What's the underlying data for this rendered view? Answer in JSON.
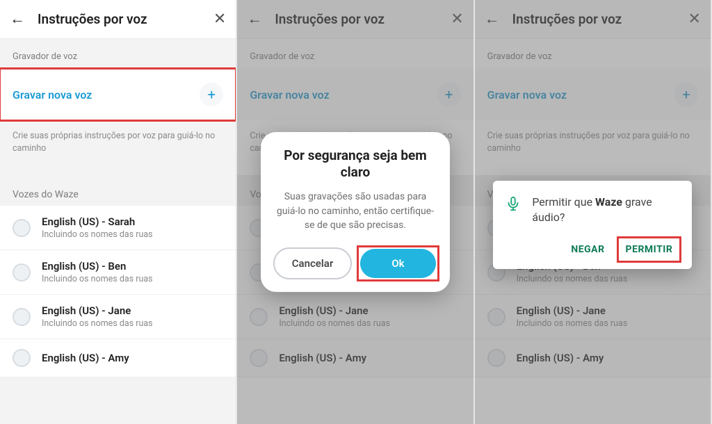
{
  "header": {
    "title": "Instruções por voz"
  },
  "recorder": {
    "section_label": "Gravador de voz",
    "record_label": "Gravar nova voz",
    "helper": "Crie suas próprias instruções por voz para guiá-lo no caminho"
  },
  "voices": {
    "section_label": "Vozes do Waze",
    "sub_label": "Incluindo os nomes das ruas",
    "items": [
      {
        "name": "English (US) - Sarah"
      },
      {
        "name": "English (US) - Ben"
      },
      {
        "name": "English (US) - Jane"
      },
      {
        "name": "English (US) - Amy"
      }
    ]
  },
  "dialog_safety": {
    "title": "Por segurança seja bem claro",
    "body": "Suas gravações são usadas para guiá-lo no caminho, então certifique-se de que são precisas.",
    "cancel": "Cancelar",
    "ok": "Ok"
  },
  "dialog_permission": {
    "prefix": "Permitir que ",
    "app": "Waze",
    "suffix": " grave áudio?",
    "deny": "NEGAR",
    "allow": "PERMITIR"
  }
}
